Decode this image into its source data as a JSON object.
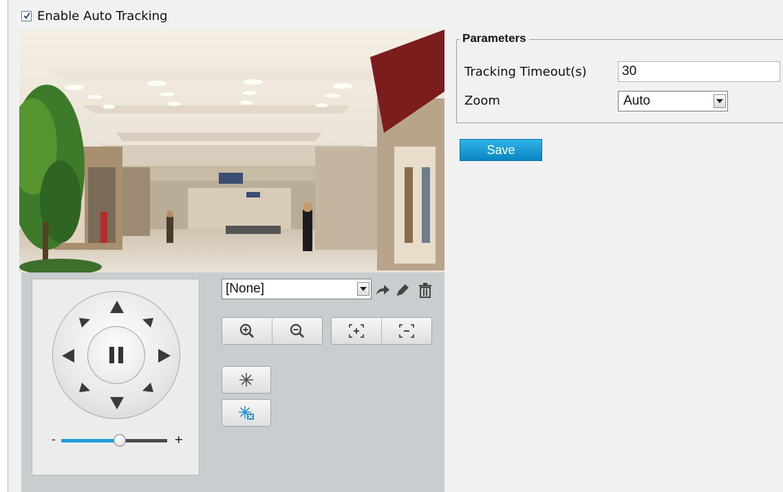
{
  "auto_tracking": {
    "label": "Enable Auto Tracking",
    "checked": true
  },
  "ptz": {
    "preset_selected": "[None]",
    "zoom_minus": "-",
    "zoom_plus": "+",
    "zoom_level": 0.55
  },
  "parameters": {
    "legend": "Parameters",
    "timeout_label": "Tracking Timeout(s)",
    "timeout_value": "30",
    "zoom_label": "Zoom",
    "zoom_value": "Auto"
  },
  "save_label": "Save",
  "colors": {
    "accent": "#1b9ed8",
    "panel": "#c8cdd0",
    "icon_blue": "#2f8fd0"
  }
}
